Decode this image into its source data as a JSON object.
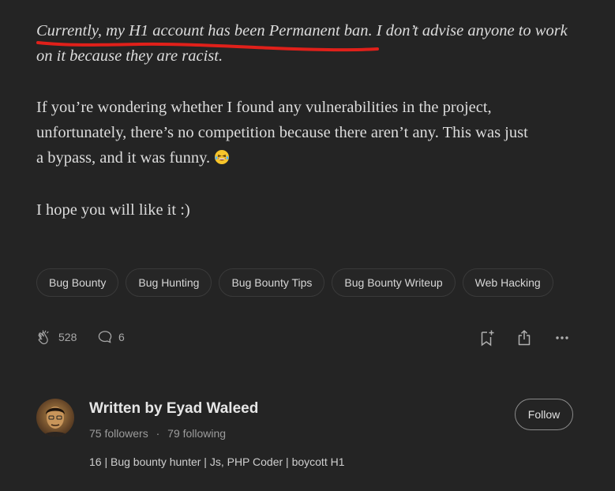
{
  "article": {
    "p1_line1": "Currently, my H1 account has been Permanent ban. I don’t advise anyone to work",
    "p1_line2": "on it because they are racist.",
    "p2_line1": "If you’re wondering whether I found any vulnerabilities in the project,",
    "p2_line2": "unfortunately, there’s no competition because there aren’t any. This was just",
    "p2_line3": "a bypass, and it was funny.",
    "p3": "I hope you will like it :)"
  },
  "tags": [
    "Bug Bounty",
    "Bug Hunting",
    "Bug Bounty Tips",
    "Bug Bounty Writeup",
    "Web Hacking"
  ],
  "actions": {
    "claps": "528",
    "responses": "6"
  },
  "author": {
    "written_by": "Written by Eyad Waleed",
    "followers": "75 followers",
    "separator": "·",
    "following": "79 following",
    "bio": "16 | Bug bounty hunter | Js, PHP Coder | boycott H1",
    "follow_label": "Follow"
  },
  "icons": {
    "clap": "clap-icon",
    "response": "response-icon",
    "save": "bookmark-add-icon",
    "share": "share-icon",
    "more": "more-icon",
    "emoji": "laughing-emoji-icon"
  },
  "colors": {
    "background": "#242424",
    "underline": "#e0201a",
    "text": "#dcdcdc"
  }
}
